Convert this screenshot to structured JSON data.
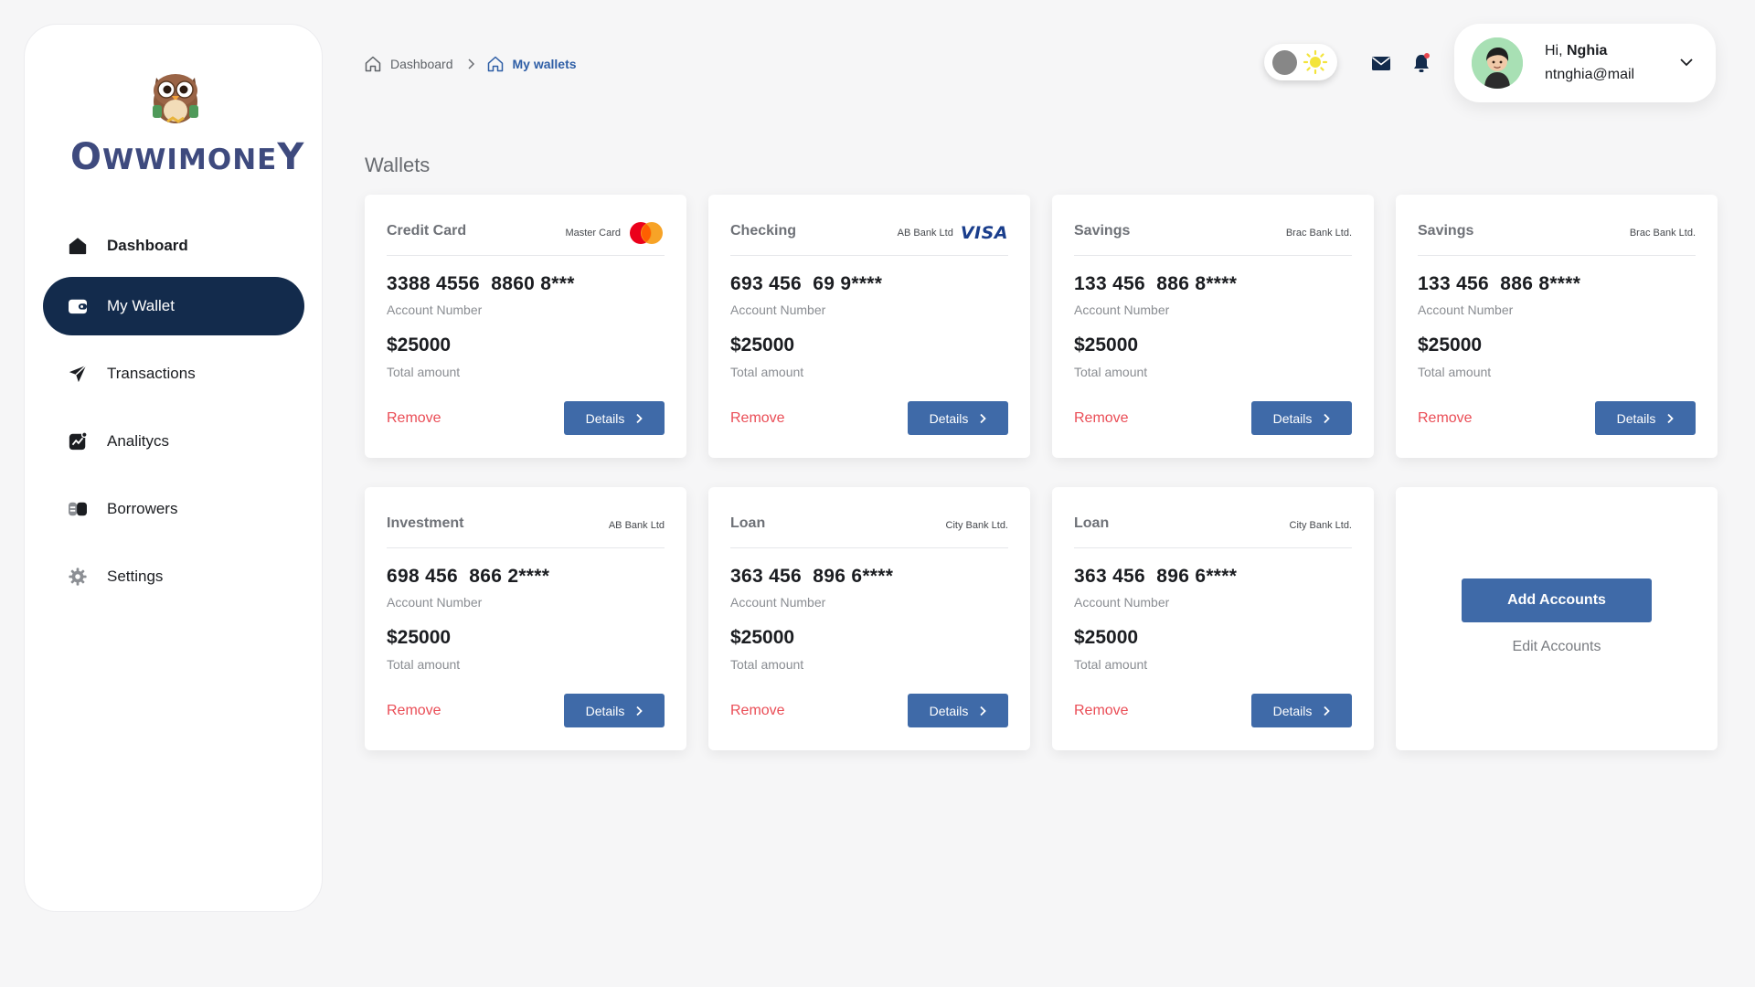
{
  "app": {
    "logo_text": "OWWIMONEY"
  },
  "sidebar": {
    "items": [
      {
        "label": "Dashboard",
        "icon": "home-icon"
      },
      {
        "label": "My Wallet",
        "icon": "wallet-icon"
      },
      {
        "label": "Transactions",
        "icon": "send-icon"
      },
      {
        "label": "Analitycs",
        "icon": "chart-icon"
      },
      {
        "label": "Borrowers",
        "icon": "borrowers-icon"
      },
      {
        "label": "Settings",
        "icon": "gear-icon"
      }
    ],
    "active": "My Wallet"
  },
  "breadcrumb": {
    "items": [
      "Dashboard",
      "My wallets"
    ]
  },
  "header": {
    "user_greeting_prefix": "Hi, ",
    "user_name": "Nghia",
    "user_email": "ntnghia@mail"
  },
  "page": {
    "title": "Wallets"
  },
  "cards": [
    {
      "type": "Credit Card",
      "bank": "Master Card",
      "brand": "mastercard",
      "number": "3388 4556  8860 8***",
      "number_label": "Account Number",
      "amount": "$25000",
      "amount_label": "Total amount",
      "remove_label": "Remove",
      "details_label": "Details"
    },
    {
      "type": "Checking",
      "bank": "AB Bank Ltd",
      "brand": "visa",
      "brand_text": "VISA",
      "number": "693 456  69 9****",
      "number_label": "Account Number",
      "amount": "$25000",
      "amount_label": "Total amount",
      "remove_label": "Remove",
      "details_label": "Details"
    },
    {
      "type": "Savings",
      "bank": "Brac Bank Ltd.",
      "brand": "",
      "number": "133 456  886 8****",
      "number_label": "Account Number",
      "amount": "$25000",
      "amount_label": "Total amount",
      "remove_label": "Remove",
      "details_label": "Details"
    },
    {
      "type": "Savings",
      "bank": "Brac Bank Ltd.",
      "brand": "",
      "number": "133 456  886 8****",
      "number_label": "Account Number",
      "amount": "$25000",
      "amount_label": "Total amount",
      "remove_label": "Remove",
      "details_label": "Details"
    },
    {
      "type": "Investment",
      "bank": "AB Bank Ltd",
      "brand": "",
      "number": "698 456  866 2****",
      "number_label": "Account Number",
      "amount": "$25000",
      "amount_label": "Total amount",
      "remove_label": "Remove",
      "details_label": "Details"
    },
    {
      "type": "Loan",
      "bank": "City Bank Ltd.",
      "brand": "",
      "number": "363 456  896 6****",
      "number_label": "Account Number",
      "amount": "$25000",
      "amount_label": "Total amount",
      "remove_label": "Remove",
      "details_label": "Details"
    },
    {
      "type": "Loan",
      "bank": "City Bank Ltd.",
      "brand": "",
      "number": "363 456  896 6****",
      "number_label": "Account Number",
      "amount": "$25000",
      "amount_label": "Total amount",
      "remove_label": "Remove",
      "details_label": "Details"
    }
  ],
  "add_panel": {
    "add_label": "Add Accounts",
    "edit_label": "Edit Accounts"
  },
  "colors": {
    "nav_active_bg": "#132b4c",
    "primary_button": "#3f6aa8",
    "remove_text": "#ea4d56",
    "breadcrumb_active": "#2e5ea6"
  }
}
